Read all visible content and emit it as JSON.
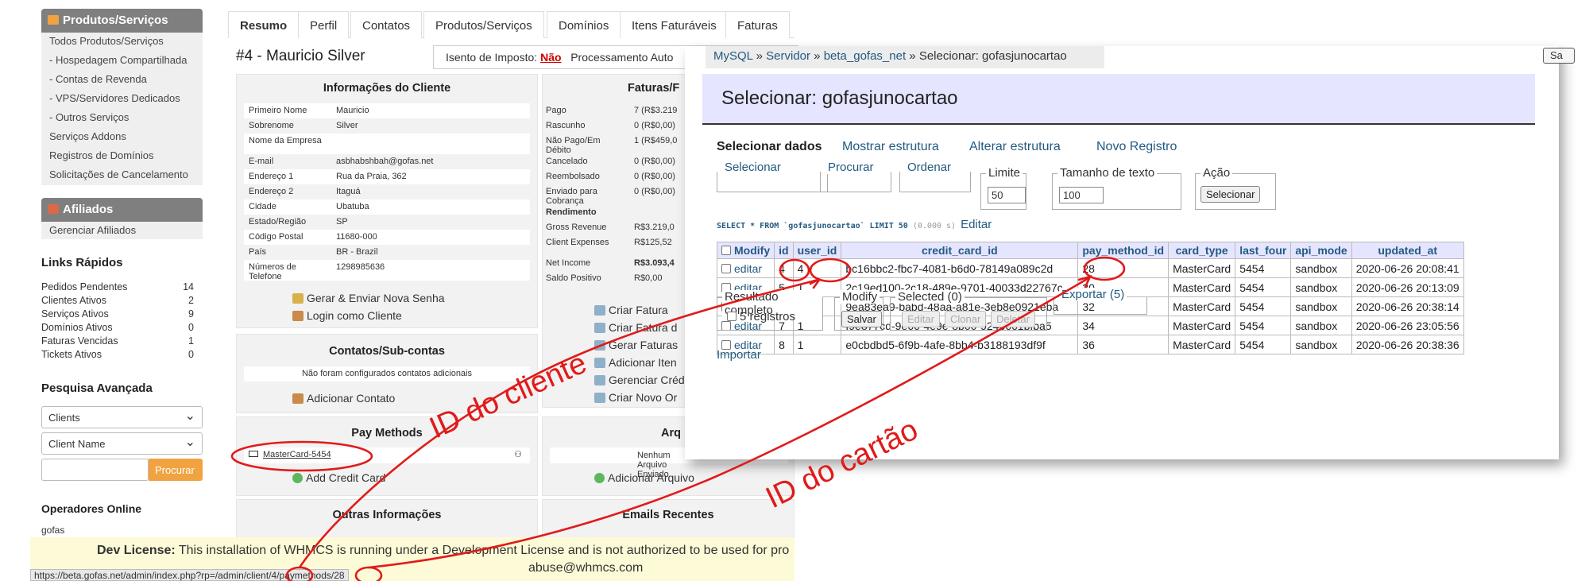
{
  "sidebar": {
    "products_header": "Produtos/Serviços",
    "products_items": [
      "Todos Produtos/Serviços",
      "- Hospedagem Compartilhada",
      "- Contas de Revenda",
      "- VPS/Servidores Dedicados",
      "- Outros Serviços",
      "Serviços Addons",
      "Registros de Domínios",
      "Solicitações de Cancelamento"
    ],
    "affiliates_header": "Afiliados",
    "affiliates_items": [
      "Gerenciar Afiliados"
    ],
    "quick_links_title": "Links Rápidos",
    "quick_links": [
      {
        "label": "Pedidos Pendentes",
        "value": "14"
      },
      {
        "label": "Clientes Ativos",
        "value": "2"
      },
      {
        "label": "Serviços Ativos",
        "value": "9"
      },
      {
        "label": "Domínios Ativos",
        "value": "0"
      },
      {
        "label": "Faturas Vencidas",
        "value": "1"
      },
      {
        "label": "Tickets Ativos",
        "value": "0"
      }
    ],
    "advanced_search_title": "Pesquisa Avançada",
    "search_select1": "Clients",
    "search_select2": "Client Name",
    "search_button": "Procurar",
    "online_title": "Operadores Online",
    "online_user": "gofas"
  },
  "tabs": [
    "Resumo",
    "Perfil",
    "Contatos",
    "Produtos/Serviços",
    "Domínios",
    "Itens Faturáveis",
    "Faturas"
  ],
  "client": {
    "title": "#4 - Mauricio Silver",
    "tax_exempt_label": "Isento de Imposto:",
    "tax_exempt_value": "Não",
    "processing_label": "Processamento Auto"
  },
  "info_panel": {
    "title": "Informações do Cliente",
    "rows": [
      {
        "k": "Primeiro Nome",
        "v": "Mauricio"
      },
      {
        "k": "Sobrenome",
        "v": "Silver"
      },
      {
        "k": "Nome da Empresa",
        "v": ""
      },
      {
        "k": "E-mail",
        "v": "asbhabshbah@gofas.net"
      },
      {
        "k": "Endereço 1",
        "v": "Rua da Praia, 362"
      },
      {
        "k": "Endereço 2",
        "v": "Itaguá"
      },
      {
        "k": "Cidade",
        "v": "Ubatuba"
      },
      {
        "k": "Estado/Região",
        "v": "SP"
      },
      {
        "k": "Código Postal",
        "v": "11680-000"
      },
      {
        "k": "País",
        "v": "BR - Brazil"
      },
      {
        "k": "Números de Telefone",
        "v": "1298985636"
      }
    ],
    "action_1": "Gerar & Enviar Nova Senha",
    "action_2": "Login como Cliente"
  },
  "invoices_panel": {
    "title": "Faturas/F",
    "rows": [
      {
        "k": "Pago",
        "v": "7 (R$3.219"
      },
      {
        "k": "Rascunho",
        "v": "0 (R$0,00)"
      },
      {
        "k": "Não Pago/Em Débito",
        "v": "1 (R$459,0"
      },
      {
        "k": "Cancelado",
        "v": "0 (R$0,00)"
      },
      {
        "k": "Reembolsado",
        "v": "0 (R$0,00)"
      },
      {
        "k": "Enviado para Cobrança",
        "v": "0 (R$0,00)"
      },
      {
        "k": "Rendimento",
        "v": ""
      },
      {
        "k": "Gross Revenue",
        "v": "R$3.219,0"
      },
      {
        "k": "Client Expenses",
        "v": "R$125,52"
      },
      {
        "k": "Net Income",
        "v": "R$3.093,4"
      },
      {
        "k": "Saldo Positivo",
        "v": "R$0,00"
      }
    ],
    "actions": [
      "Criar Fatura",
      "Criar Fatura d",
      "Gerar Faturas",
      "Adicionar Iten",
      "Gerenciar Créd",
      "Criar Novo Or"
    ]
  },
  "contacts_panel": {
    "title": "Contatos/Sub-contas",
    "empty": "Não foram configurados contatos adicionais",
    "add": "Adicionar Contato"
  },
  "paymethods_panel": {
    "title": "Pay Methods",
    "item": "MasterCard-5454",
    "add": "Add Credit Card"
  },
  "files_panel": {
    "title": "Arq",
    "empty": "Nenhum Arquivo Enviado",
    "add": "Adicionar Arquivo"
  },
  "other_info_title": "Outras Informações",
  "recent_emails_title": "Emails Recentes",
  "dev_license": {
    "bold": "Dev License:",
    "text": "This installation of WHMCS is running under a Development License and is not authorized to be used for pro",
    "email": "abuse@whmcs.com"
  },
  "status_url": "https://beta.gofas.net/admin/index.php?rp=/admin/client/4/paymethods/28",
  "pma": {
    "breadcrumb": [
      "MySQL",
      "Servidor",
      "beta_gofas_net",
      "Selecionar: gofasjunocartao"
    ],
    "title": "Selecionar: gofasjunocartao",
    "tabs": [
      "Selecionar dados",
      "Mostrar estrutura",
      "Alterar estrutura",
      "Novo Registro"
    ],
    "fieldsets": {
      "select": "Selecionar",
      "search": "Procurar",
      "order": "Ordenar",
      "limit": "Limite",
      "limit_value": "50",
      "textlen": "Tamanho de texto",
      "textlen_value": "100",
      "action": "Ação",
      "action_button": "Selecionar"
    },
    "query": {
      "sql": "SELECT * FROM `gofasjunocartao` LIMIT 50",
      "time": "(0.000 s)",
      "edit": "Editar"
    },
    "columns": [
      "Modify",
      "id",
      "user_id",
      "credit_card_id",
      "pay_method_id",
      "card_type",
      "last_four",
      "api_mode",
      "updated_at"
    ],
    "rows": [
      {
        "modify": "editar",
        "id": "4",
        "user_id": "4",
        "credit_card_id": "bc16bbc2-fbc7-4081-b6d0-78149a089c2d",
        "pay_method_id": "28",
        "card_type": "MasterCard",
        "last_four": "5454",
        "api_mode": "sandbox",
        "updated_at": "2020-06-26 20:08:41"
      },
      {
        "modify": "editar",
        "id": "5",
        "user_id": "1",
        "credit_card_id": "2c19ed100-2c18-489e-9701-40033d22767c",
        "pay_method_id": "30",
        "card_type": "MasterCard",
        "last_four": "5454",
        "api_mode": "sandbox",
        "updated_at": "2020-06-26 20:13:09"
      },
      {
        "modify": "editar",
        "id": "6",
        "user_id": "1",
        "credit_card_id": "9ea83ea9-babd-48aa-a81e-3eb8e0921eba",
        "pay_method_id": "32",
        "card_type": "MasterCard",
        "last_four": "5454",
        "api_mode": "sandbox",
        "updated_at": "2020-06-26 20:38:14"
      },
      {
        "modify": "editar",
        "id": "7",
        "user_id": "1",
        "credit_card_id": "f9e877cd-9e66-4e9e-8b00-924b661bfba5",
        "pay_method_id": "34",
        "card_type": "MasterCard",
        "last_four": "5454",
        "api_mode": "sandbox",
        "updated_at": "2020-06-26 23:05:56"
      },
      {
        "modify": "editar",
        "id": "8",
        "user_id": "1",
        "credit_card_id": "e0cbdbd5-6f9b-4afe-8bb4-b3188193df9f",
        "pay_method_id": "36",
        "card_type": "MasterCard",
        "last_four": "5454",
        "api_mode": "sandbox",
        "updated_at": "2020-06-26 20:38:36"
      }
    ],
    "result_label": "Resultado completo",
    "result_check": "5 registros",
    "modify_label": "Modify",
    "save_button": "Salvar",
    "selected_label": "Selected (0)",
    "edit_btn": "Editar",
    "clone_btn": "Clonar",
    "delete_btn": "Deletar",
    "export_link": "Exportar (5)",
    "import_link": "Importar",
    "side_button": "Sa"
  },
  "annotations": {
    "client_id": "ID do cliente",
    "card_id": "ID do cartão",
    "color": "#e11a1a"
  }
}
